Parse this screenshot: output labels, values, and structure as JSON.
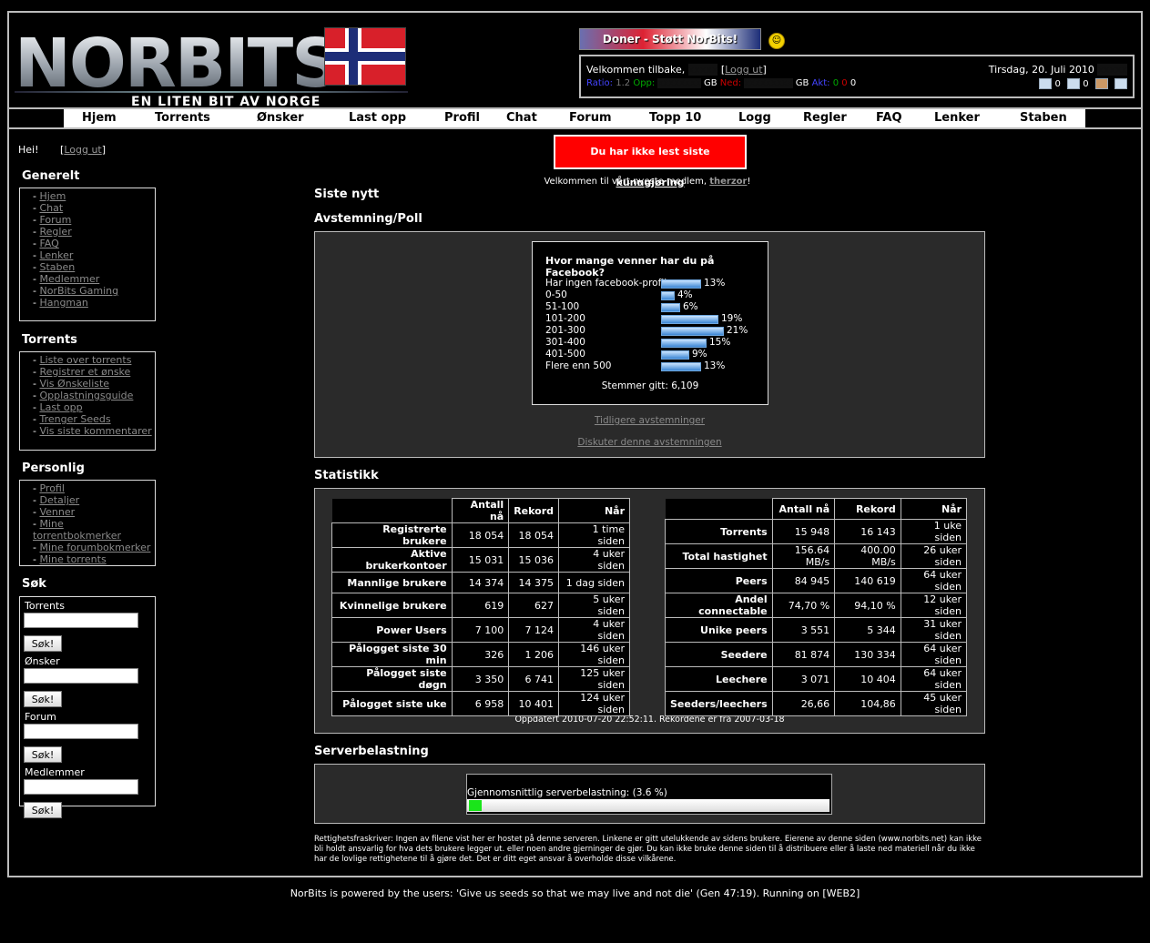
{
  "header": {
    "logo_text": "NORBITS",
    "tagline": "EN LITEN BIT AV NORGE",
    "donate_label": "Doner - Støtt NorBits!",
    "smiley_icon": "smiley-icon"
  },
  "userbox": {
    "welcome": "Velkommen tilbake,",
    "logout": "Logg ut",
    "ratio_label": "Ratio:",
    "ratio_value": "1.2",
    "up_label": "Opp:",
    "down_label": "Ned:",
    "gb": "GB",
    "active_label": "Akt:",
    "active_seed": "0",
    "active_leech": "0",
    "date": "Tirsdag, 20. Juli 2010",
    "pm_count": "0",
    "inbox_count": "0",
    "colors": {
      "ratio": "#4444ff",
      "up": "#00aa00",
      "down": "#cc0000",
      "active": "#4444ff"
    }
  },
  "nav": [
    "Hjem",
    "Torrents",
    "Ønsker",
    "Last opp",
    "Profil",
    "Chat",
    "Forum",
    "Topp 10",
    "Logg",
    "Regler",
    "FAQ",
    "Lenker",
    "Staben"
  ],
  "sidebar": {
    "hei": "Hei!",
    "logout": "Logg ut",
    "sections": [
      {
        "title": "Generelt",
        "items": [
          "Hjem",
          "Chat",
          "Forum",
          "Regler",
          "FAQ",
          "Lenker",
          "Staben",
          "Medlemmer",
          "NorBits Gaming",
          "Hangman"
        ]
      },
      {
        "title": "Torrents",
        "items": [
          "Liste over torrents",
          "Registrer et ønske",
          "Vis Ønskeliste",
          "Opplastningsguide",
          "Last opp",
          "Trenger Seeds",
          "Vis siste kommentarer"
        ]
      },
      {
        "title": "Personlig",
        "items": [
          "Profil",
          "Detaljer",
          "Venner",
          "Mine torrentbokmerker",
          "Mine forumbokmerker",
          "Mine torrents"
        ]
      }
    ],
    "search": {
      "title": "Søk",
      "fields": [
        "Torrents",
        "Ønsker",
        "Forum",
        "Medlemmer"
      ],
      "button": "Søk!"
    }
  },
  "main": {
    "alert_text": "Du har ikke lest siste ",
    "alert_link": "kunngjøring",
    "welcome_text": "Velkommen til vårt nyeste medlem, ",
    "newest_member": "therzor",
    "welcome_end": "!",
    "news_title": "Siste nytt",
    "poll_title": "Avstemning/Poll",
    "poll": {
      "question": "Hvor mange venner har du på Facebook?",
      "options": [
        {
          "label": "Har ingen facebook-profil",
          "pct": 13
        },
        {
          "label": "0-50",
          "pct": 4
        },
        {
          "label": "51-100",
          "pct": 6
        },
        {
          "label": "101-200",
          "pct": 19
        },
        {
          "label": "201-300",
          "pct": 21
        },
        {
          "label": "301-400",
          "pct": 15
        },
        {
          "label": "401-500",
          "pct": 9
        },
        {
          "label": "Flere enn 500",
          "pct": 13
        }
      ],
      "total": "Stemmer gitt: 6,109",
      "previous": "Tidligere avstemninger",
      "discuss": "Diskuter denne avstemningen"
    },
    "stats_title": "Statistikk",
    "stats_headers": [
      "Antall nå",
      "Rekord",
      "Når"
    ],
    "stats_left": [
      [
        "Registrerte brukere",
        "18 054",
        "18 054",
        "1 time siden"
      ],
      [
        "Aktive brukerkontoer",
        "15 031",
        "15 036",
        "4 uker siden"
      ],
      [
        "Mannlige brukere",
        "14 374",
        "14 375",
        "1 dag siden"
      ],
      [
        "Kvinnelige brukere",
        "619",
        "627",
        "5 uker siden"
      ],
      [
        "Power Users",
        "7 100",
        "7 124",
        "4 uker siden"
      ],
      [
        "Pålogget siste 30 min",
        "326",
        "1 206",
        "146 uker siden"
      ],
      [
        "Pålogget siste døgn",
        "3 350",
        "6 741",
        "125 uker siden"
      ],
      [
        "Pålogget siste uke",
        "6 958",
        "10 401",
        "124 uker siden"
      ]
    ],
    "stats_right": [
      [
        "Torrents",
        "15 948",
        "16 143",
        "1 uke siden"
      ],
      [
        "Total hastighet",
        "156.64 MB/s",
        "400.00 MB/s",
        "26 uker siden"
      ],
      [
        "Peers",
        "84 945",
        "140 619",
        "64 uker siden"
      ],
      [
        "Andel connectable",
        "74,70 %",
        "94,10 %",
        "12 uker siden"
      ],
      [
        "Unike peers",
        "3 551",
        "5 344",
        "31 uker siden"
      ],
      [
        "Seedere",
        "81 874",
        "130 334",
        "64 uker siden"
      ],
      [
        "Leechere",
        "3 071",
        "10 404",
        "64 uker siden"
      ],
      [
        "Seeders/leechers",
        "26,66",
        "104,86",
        "45 uker siden"
      ]
    ],
    "updated": "Oppdatert 2010-07-20 22:52:11. Rekordene er fra 2007-03-18",
    "load_title": "Serverbelastning",
    "load_text": "Gjennomsnittlig serverbelastning: (3.6 %)",
    "load_pct": 3.6,
    "disclaimer": "Rettighetsfraskriver: Ingen av filene vist her er hostet på denne serveren. Linkene er gitt utelukkende av sidens brukere. Eierene av denne siden (www.norbits.net) kan ikke bli holdt ansvarlig for hva dets brukere legger ut. eller noen andre gjerninger de gjør. Du kan ikke bruke denne siden til å distribuere eller å laste ned materiell når du ikke har de lovlige rettighetene til å gjøre det. Det er ditt eget ansvar å overholde disse vilkårene."
  },
  "footer": "NorBits is powered by the users: 'Give us seeds so that we may live and not die' (Gen 47:19). Running on [WEB2]"
}
